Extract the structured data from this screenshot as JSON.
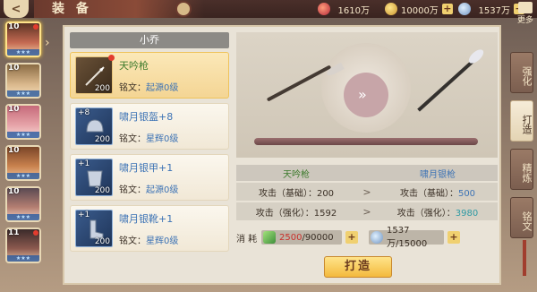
{
  "header": {
    "back_label": "<",
    "title": "装 备",
    "resources": [
      {
        "icon": "gem-icon",
        "value": "1610万",
        "has_plus": false
      },
      {
        "icon": "gold-icon",
        "value": "10000万",
        "has_plus": true
      },
      {
        "icon": "silver-icon",
        "value": "1537万",
        "has_plus": true
      }
    ],
    "menu_label": "更多"
  },
  "heroes": [
    {
      "level": "10",
      "selected": true,
      "alert": true,
      "color": "#c46a52"
    },
    {
      "level": "10",
      "selected": false,
      "alert": false,
      "color": "#d8b68a"
    },
    {
      "level": "10",
      "selected": false,
      "alert": false,
      "color": "#e6a3a8"
    },
    {
      "level": "10",
      "selected": false,
      "alert": false,
      "color": "#c9824e"
    },
    {
      "level": "10",
      "selected": false,
      "alert": false,
      "color": "#b57f72"
    },
    {
      "level": "11",
      "selected": false,
      "alert": true,
      "color": "#8c5a4f"
    }
  ],
  "hero_name": "小乔",
  "equipment": [
    {
      "name": "天吟枪",
      "plus": "",
      "qty": "200",
      "seal_label": "铭文：",
      "seal_value": "起源0级",
      "selected": true,
      "alert": true,
      "name_color": "green"
    },
    {
      "name": "啸月银盔+8",
      "plus": "+8",
      "qty": "200",
      "seal_label": "铭文：",
      "seal_value": "星辉0级",
      "selected": false,
      "alert": false,
      "name_color": "blue"
    },
    {
      "name": "啸月银甲+1",
      "plus": "+1",
      "qty": "200",
      "seal_label": "铭文：",
      "seal_value": "起源0级",
      "selected": false,
      "alert": false,
      "name_color": "blue"
    },
    {
      "name": "啸月银靴+1",
      "plus": "+1",
      "qty": "200",
      "seal_label": "铭文：",
      "seal_value": "星辉0级",
      "selected": false,
      "alert": false,
      "name_color": "blue"
    }
  ],
  "forge": {
    "current_name": "天吟枪",
    "target_name": "啸月银枪",
    "rows": [
      {
        "label_left": "攻击（基础）：",
        "value_left": "200",
        "label_right": "攻击（基础）：",
        "value_right": "500"
      },
      {
        "label_left": "攻击（强化）：",
        "value_left": "1592",
        "label_right": "攻击（强化）：",
        "value_right": "3980"
      }
    ],
    "cost_label": "消 耗",
    "cost_material": {
      "current": "2500",
      "total": "/90000"
    },
    "cost_silver": {
      "value": "1537万/15000"
    },
    "forge_button": "打造"
  },
  "tabs": [
    {
      "label": "强化",
      "active": false
    },
    {
      "label": "打造",
      "active": true
    },
    {
      "label": "精炼",
      "active": false
    },
    {
      "label": "铭文",
      "active": false
    }
  ]
}
